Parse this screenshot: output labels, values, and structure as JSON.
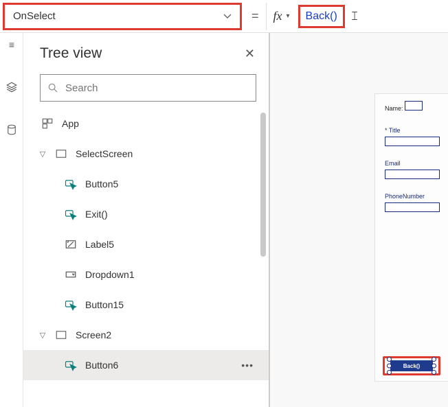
{
  "formula_bar": {
    "property": "OnSelect",
    "equals": "=",
    "fx": "fx",
    "value": "Back()"
  },
  "tree": {
    "title": "Tree view",
    "search_placeholder": "Search",
    "app_label": "App",
    "screens": [
      {
        "name": "SelectScreen",
        "children": [
          {
            "label": "Button5",
            "type": "button"
          },
          {
            "label": "Exit()",
            "type": "button"
          },
          {
            "label": "Label5",
            "type": "label"
          },
          {
            "label": "Dropdown1",
            "type": "dropdown"
          },
          {
            "label": "Button15",
            "type": "button"
          }
        ]
      },
      {
        "name": "Screen2",
        "children": [
          {
            "label": "Button6",
            "type": "button",
            "selected": true
          }
        ]
      }
    ],
    "more": "•••"
  },
  "canvas": {
    "form": {
      "name_label": "Name:",
      "title_label": "Title",
      "email_label": "Email",
      "phone_label": "PhoneNumber"
    },
    "selected_button_text": "Back()"
  }
}
